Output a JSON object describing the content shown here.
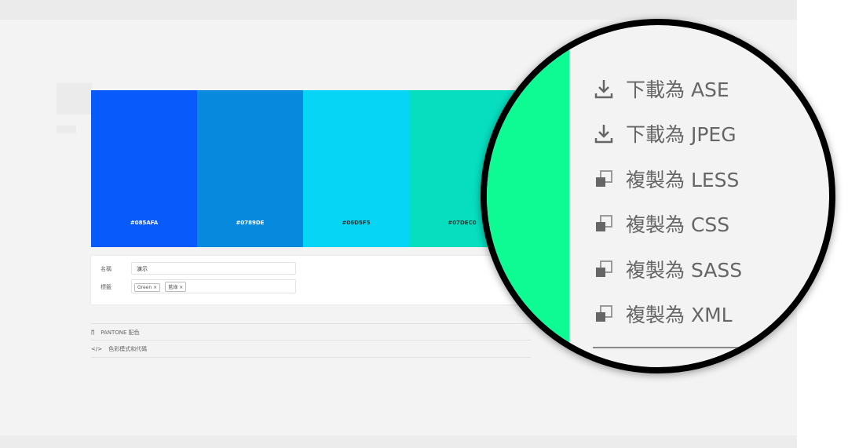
{
  "swatches": [
    {
      "hex": "#085AFA",
      "color": "#085afa",
      "text": "#ffffff"
    },
    {
      "hex": "#0789DE",
      "color": "#0789de",
      "text": "#ffffff"
    },
    {
      "hex": "#06D5F5",
      "color": "#06d5f5",
      "text": "#333333"
    },
    {
      "hex": "#07DEC0",
      "color": "#07dec0",
      "text": "#333333"
    }
  ],
  "form": {
    "name_label": "名稱",
    "name_value": "演示",
    "tags_label": "標籤",
    "tags": [
      "Green",
      "藍綠"
    ],
    "tag_remove": "×"
  },
  "sections": [
    {
      "icon": "pantone-icon",
      "label": "PANTONE 配色"
    },
    {
      "icon": "code-icon",
      "label": "色彩模式和代碼"
    }
  ],
  "magnified_menu": {
    "accent": "#0efa93",
    "items": [
      {
        "icon": "download-icon",
        "label": "下載為 ASE"
      },
      {
        "icon": "download-icon",
        "label": "下載為 JPEG"
      },
      {
        "icon": "copy-icon",
        "label": "複製為 LESS"
      },
      {
        "icon": "copy-icon",
        "label": "複製為 CSS"
      },
      {
        "icon": "copy-icon",
        "label": "複製為 SASS"
      },
      {
        "icon": "copy-icon",
        "label": "複製為 XML"
      }
    ]
  }
}
